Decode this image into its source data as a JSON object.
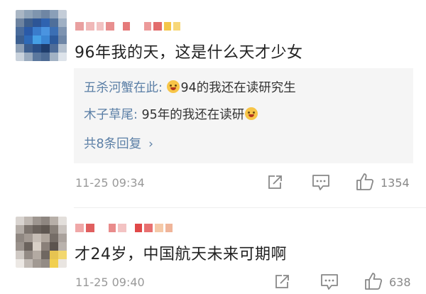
{
  "comments": [
    {
      "text": "96年我的天，这是什么天才少女",
      "replies": [
        {
          "user": "五杀河蟹在此:",
          "text": "94的我还在读研究生",
          "emoji_before": true,
          "emoji_after": false
        },
        {
          "user": "木子草尾:",
          "text": "95年的我还在读研",
          "emoji_before": false,
          "emoji_after": true
        }
      ],
      "more_replies": "共8条回复",
      "more_chevron": "›",
      "time": "11-25 09:34",
      "like_count": "1354"
    },
    {
      "text": "才24岁，中国航天未来可期啊",
      "time": "11-25 09:40",
      "like_count": "638"
    }
  ],
  "icons": {
    "share": "share-icon",
    "comment": "comment-icon",
    "like": "thumbs-up-icon",
    "emoji": "smile-emoji-icon"
  },
  "colors": {
    "username_link": "#5b7fa6",
    "reply_bg": "#f5f5f5",
    "meta_gray": "#999999"
  }
}
